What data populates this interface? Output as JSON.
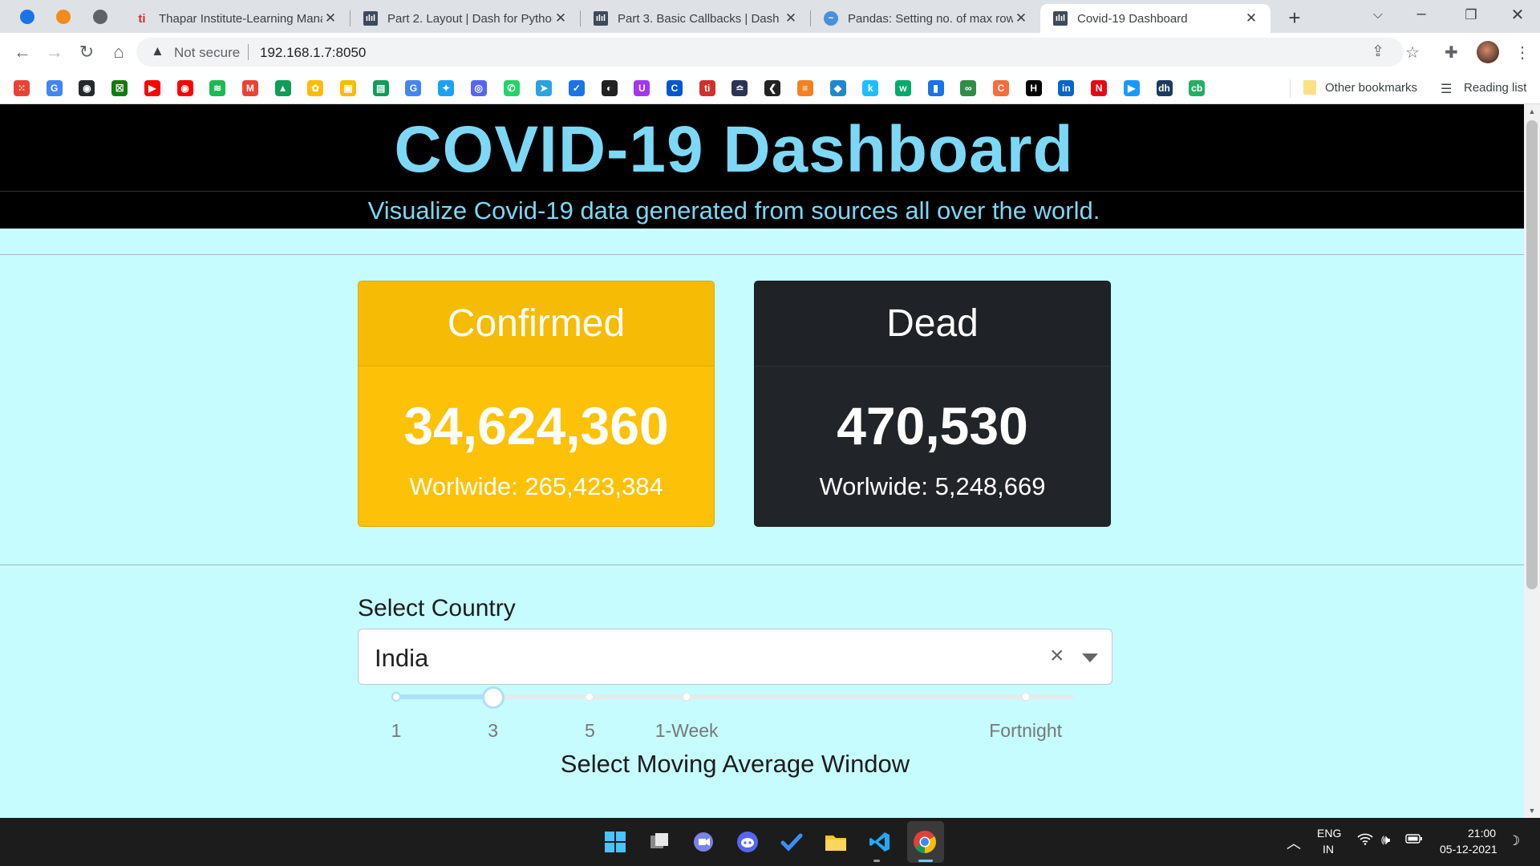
{
  "browser": {
    "tabs": [
      {
        "title": "Thapar Institute-Learning Mana",
        "icon": "thapar-icon",
        "fav_text": "ti"
      },
      {
        "title": "Part 2. Layout | Dash for Python",
        "icon": "dash-icon",
        "fav_text": "ılıl"
      },
      {
        "title": "Part 3. Basic Callbacks | Dash fo",
        "icon": "dash-icon",
        "fav_text": "ılıl"
      },
      {
        "title": "Pandas: Setting no. of max row",
        "icon": "stackabuse-icon",
        "fav_text": "~"
      },
      {
        "title": "Covid-19 Dashboard",
        "icon": "dash-icon",
        "fav_text": "ılıl",
        "active": true
      }
    ],
    "security_label": "Not secure",
    "url": "192.168.1.7:8050",
    "bookmarks_other": "Other bookmarks",
    "reading_list": "Reading list",
    "bookmark_icons": [
      {
        "name": "apps-icon",
        "color": "#ea4335",
        "glyph": "⁙"
      },
      {
        "name": "google-icon",
        "color": "#4285f4",
        "glyph": "G"
      },
      {
        "name": "github-icon",
        "color": "#24292e",
        "glyph": "◉"
      },
      {
        "name": "xbox-icon",
        "color": "#107c10",
        "glyph": "☒"
      },
      {
        "name": "youtube-icon",
        "color": "#ff0000",
        "glyph": "▶"
      },
      {
        "name": "youtube-music-icon",
        "color": "#ff0000",
        "glyph": "◉"
      },
      {
        "name": "spotify-icon",
        "color": "#1db954",
        "glyph": "≋"
      },
      {
        "name": "gmail-icon",
        "color": "#ea4335",
        "glyph": "M"
      },
      {
        "name": "drive-icon",
        "color": "#0f9d58",
        "glyph": "▲"
      },
      {
        "name": "photos-icon",
        "color": "#fbbc05",
        "glyph": "✿"
      },
      {
        "name": "keep-icon",
        "color": "#fbbc04",
        "glyph": "▣"
      },
      {
        "name": "classroom-icon",
        "color": "#0f9d58",
        "glyph": "▤"
      },
      {
        "name": "gsuite-icon",
        "color": "#4285f4",
        "glyph": "G"
      },
      {
        "name": "twitter-icon",
        "color": "#1da1f2",
        "glyph": "✦"
      },
      {
        "name": "discord-icon",
        "color": "#5865f2",
        "glyph": "◎"
      },
      {
        "name": "whatsapp-icon",
        "color": "#25d366",
        "glyph": "✆"
      },
      {
        "name": "telegram-icon",
        "color": "#2aa3de",
        "glyph": "➤"
      },
      {
        "name": "tasks-icon",
        "color": "#1a73e8",
        "glyph": "✓"
      },
      {
        "name": "codechef-icon",
        "color": "#222222",
        "glyph": "◐"
      },
      {
        "name": "udemy-icon",
        "color": "#a435f0",
        "glyph": "U"
      },
      {
        "name": "coursera-icon",
        "color": "#0056d2",
        "glyph": "C"
      },
      {
        "name": "thapar-bm-icon",
        "color": "#d32f2f",
        "glyph": "ti"
      },
      {
        "name": "hackerearth-icon",
        "color": "#2c3454",
        "glyph": "≏"
      },
      {
        "name": "leetcode-icon",
        "color": "#222222",
        "glyph": "❮"
      },
      {
        "name": "stackoverflow-icon",
        "color": "#f48024",
        "glyph": "≡"
      },
      {
        "name": "codeforces-icon",
        "color": "#1f8acb",
        "glyph": "◆"
      },
      {
        "name": "kaggle-icon",
        "color": "#20beff",
        "glyph": "k"
      },
      {
        "name": "w3schools-icon",
        "color": "#04aa6d",
        "glyph": "w"
      },
      {
        "name": "stats-icon",
        "color": "#1a73e8",
        "glyph": "▮"
      },
      {
        "name": "geeksforgeeks-icon",
        "color": "#2f8d46",
        "glyph": "∞"
      },
      {
        "name": "coding-ninjas-icon",
        "color": "#f66c3b",
        "glyph": "C"
      },
      {
        "name": "hackerrank-icon",
        "color": "#000000",
        "glyph": "H"
      },
      {
        "name": "linkedin-icon",
        "color": "#0a66c2",
        "glyph": "in"
      },
      {
        "name": "netflix-icon",
        "color": "#e50914",
        "glyph": "N"
      },
      {
        "name": "prime-video-icon",
        "color": "#1a98ff",
        "glyph": "▶"
      },
      {
        "name": "dh-icon",
        "color": "#1e3a5f",
        "glyph": "dh"
      },
      {
        "name": "cb-icon",
        "color": "#27ae60",
        "glyph": "cb"
      }
    ]
  },
  "dashboard": {
    "title": "COVID-19 Dashboard",
    "subtitle": "Visualize Covid-19 data generated from sources all over the world.",
    "confirmed": {
      "label": "Confirmed",
      "value": "34,624,360",
      "worldwide": "Worlwide: 265,423,384",
      "color": "#fdc107"
    },
    "dead": {
      "label": "Dead",
      "value": "470,530",
      "worldwide": "Worlwide: 5,248,669",
      "color": "#212428"
    },
    "country_select": {
      "label": "Select Country",
      "value": "India",
      "clear_glyph": "×"
    },
    "moving_average": {
      "caption": "Select Moving Average Window",
      "marks": [
        "1",
        "3",
        "5",
        "1-Week",
        "Fortnight"
      ],
      "mark_values": [
        1,
        3,
        5,
        7,
        14
      ],
      "selected_value": 3
    }
  },
  "taskbar": {
    "apps": [
      {
        "name": "start-icon"
      },
      {
        "name": "task-view-icon"
      },
      {
        "name": "teams-chat-icon"
      },
      {
        "name": "discord-taskbar-icon"
      },
      {
        "name": "todo-icon"
      },
      {
        "name": "file-explorer-icon"
      },
      {
        "name": "vscode-icon"
      },
      {
        "name": "chrome-icon"
      }
    ],
    "language": "ENG",
    "region": "IN",
    "time": "21:00",
    "date": "05-12-2021"
  }
}
